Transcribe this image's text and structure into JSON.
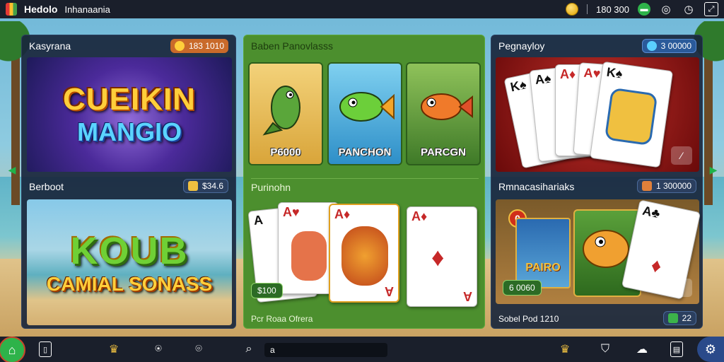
{
  "app": {
    "title": "Hedolo",
    "subtitle": "Inhanaania"
  },
  "topbar": {
    "balance": "180 300",
    "gem_icon": "gem-icon",
    "icons": [
      "coin-icon",
      "gem-icon",
      "target-icon",
      "clock-icon",
      "fullscreen-icon"
    ]
  },
  "left_panel": {
    "section1": {
      "label": "Kasyrana",
      "chip_value": "183 1010"
    },
    "banner1": {
      "line1": "CUEIKIN",
      "line2": "MANGIO"
    },
    "section2": {
      "label": "Berboot",
      "chip_value": "$34.6"
    },
    "banner2": {
      "line1": "KOUB",
      "line2": "CAMIAL SONASS"
    }
  },
  "mid_panel": {
    "section1": {
      "label": "Baben Panovlasss"
    },
    "fish_tiles": [
      {
        "name": "P6000"
      },
      {
        "name": "PANCHON"
      },
      {
        "name": "PARCGN"
      }
    ],
    "section2": {
      "label": "Purinohn"
    },
    "price_chip": "$100",
    "footer": "Pcr Roaa Ofrera"
  },
  "right_panel": {
    "section1": {
      "label": "Pegnayloy",
      "chip_value": "3 00000"
    },
    "section2": {
      "label": "Rmnacasihariaks",
      "chip_value": "1 300000"
    },
    "badge_number": "0",
    "price_chip": "6 0060",
    "tile_label": "PAIRO",
    "footer": "Sobel Pod 1210",
    "footer_chip": "22"
  },
  "bottombar": {
    "search_value": "a",
    "icons": [
      "home-icon",
      "wallet-icon",
      "crown-icon",
      "chip-icon",
      "location-icon",
      "search-icon",
      "trophy-icon",
      "shield-icon",
      "cloud-icon",
      "news-icon",
      "settings-icon"
    ]
  }
}
